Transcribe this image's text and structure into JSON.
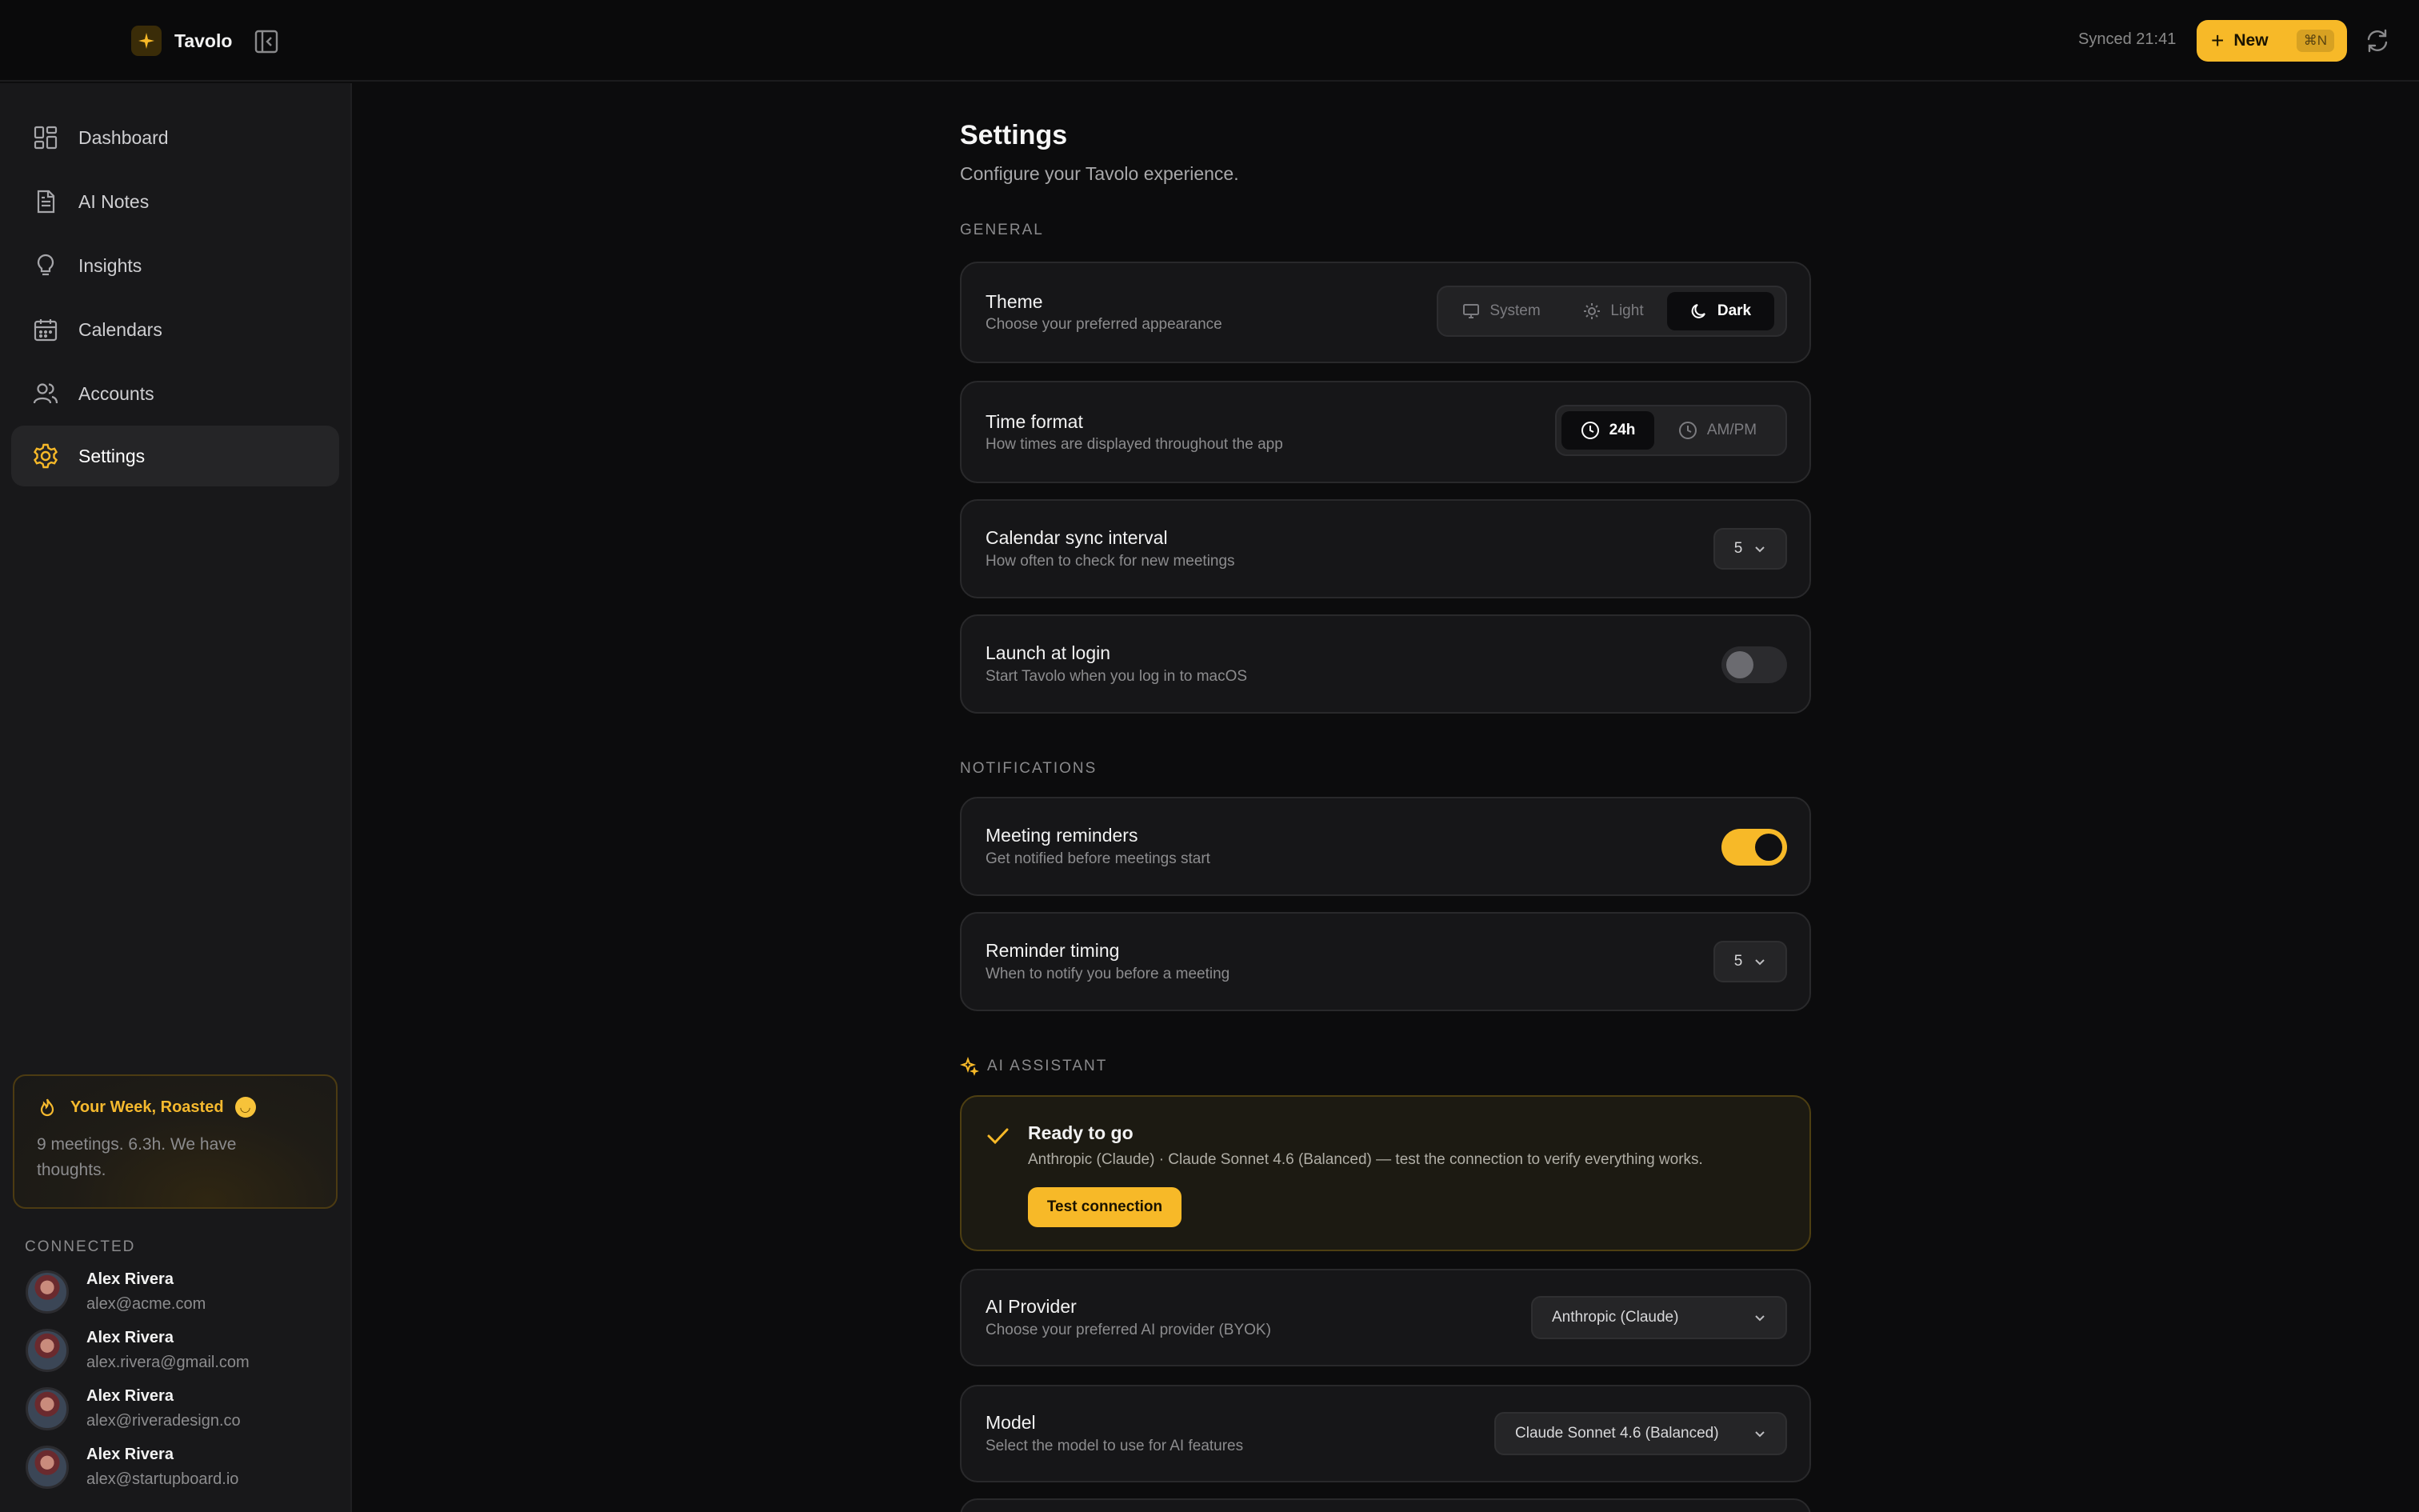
{
  "app": {
    "name": "Tavolo"
  },
  "header": {
    "synced": "Synced 21:41",
    "new_label": "New",
    "new_shortcut": "⌘N"
  },
  "sidebar": {
    "items": [
      {
        "label": "Dashboard",
        "icon": "dashboard-grid-icon"
      },
      {
        "label": "AI Notes",
        "icon": "document-icon"
      },
      {
        "label": "Insights",
        "icon": "lightbulb-icon"
      },
      {
        "label": "Calendars",
        "icon": "calendar-icon"
      },
      {
        "label": "Accounts",
        "icon": "users-icon"
      },
      {
        "label": "Settings",
        "icon": "gear-icon",
        "active": true
      }
    ],
    "roast": {
      "title": "Your Week, Roasted",
      "emoji": "🙃",
      "body": "9 meetings. 6.3h. We have thoughts."
    },
    "connected_label": "CONNECTED",
    "accounts": [
      {
        "name": "Alex Rivera",
        "email": "alex@acme.com"
      },
      {
        "name": "Alex Rivera",
        "email": "alex.rivera@gmail.com"
      },
      {
        "name": "Alex Rivera",
        "email": "alex@riveradesign.co"
      },
      {
        "name": "Alex Rivera",
        "email": "alex@startupboard.io"
      }
    ]
  },
  "settings": {
    "title": "Settings",
    "subtitle": "Configure your Tavolo experience.",
    "general": {
      "label": "GENERAL",
      "theme": {
        "title": "Theme",
        "desc": "Choose your preferred appearance",
        "options": [
          "System",
          "Light",
          "Dark"
        ],
        "selected": "Dark"
      },
      "time_format": {
        "title": "Time format",
        "desc": "How times are displayed throughout the app",
        "options": [
          "24h",
          "AM/PM"
        ],
        "selected": "24h"
      },
      "sync_interval": {
        "title": "Calendar sync interval",
        "desc": "How often to check for new meetings",
        "value": "5"
      },
      "launch_login": {
        "title": "Launch at login",
        "desc": "Start Tavolo when you log in to macOS",
        "enabled": false
      }
    },
    "notifications": {
      "label": "NOTIFICATIONS",
      "reminders": {
        "title": "Meeting reminders",
        "desc": "Get notified before meetings start",
        "enabled": true
      },
      "timing": {
        "title": "Reminder timing",
        "desc": "When to notify you before a meeting",
        "value": "5"
      }
    },
    "ai": {
      "label": "AI ASSISTANT",
      "ready": {
        "title": "Ready to go",
        "desc": "Anthropic (Claude) · Claude Sonnet 4.6 (Balanced) — test the connection to verify everything works.",
        "button": "Test connection"
      },
      "provider": {
        "title": "AI Provider",
        "desc": "Choose your preferred AI provider (BYOK)",
        "value": "Anthropic (Claude)"
      },
      "model": {
        "title": "Model",
        "desc": "Select the model to use for AI features",
        "value": "Claude Sonnet 4.6 (Balanced)"
      }
    }
  },
  "colors": {
    "accent": "#f7b928",
    "background": "#0c0c0d",
    "sidebar": "#18181a",
    "card": "#161618"
  }
}
